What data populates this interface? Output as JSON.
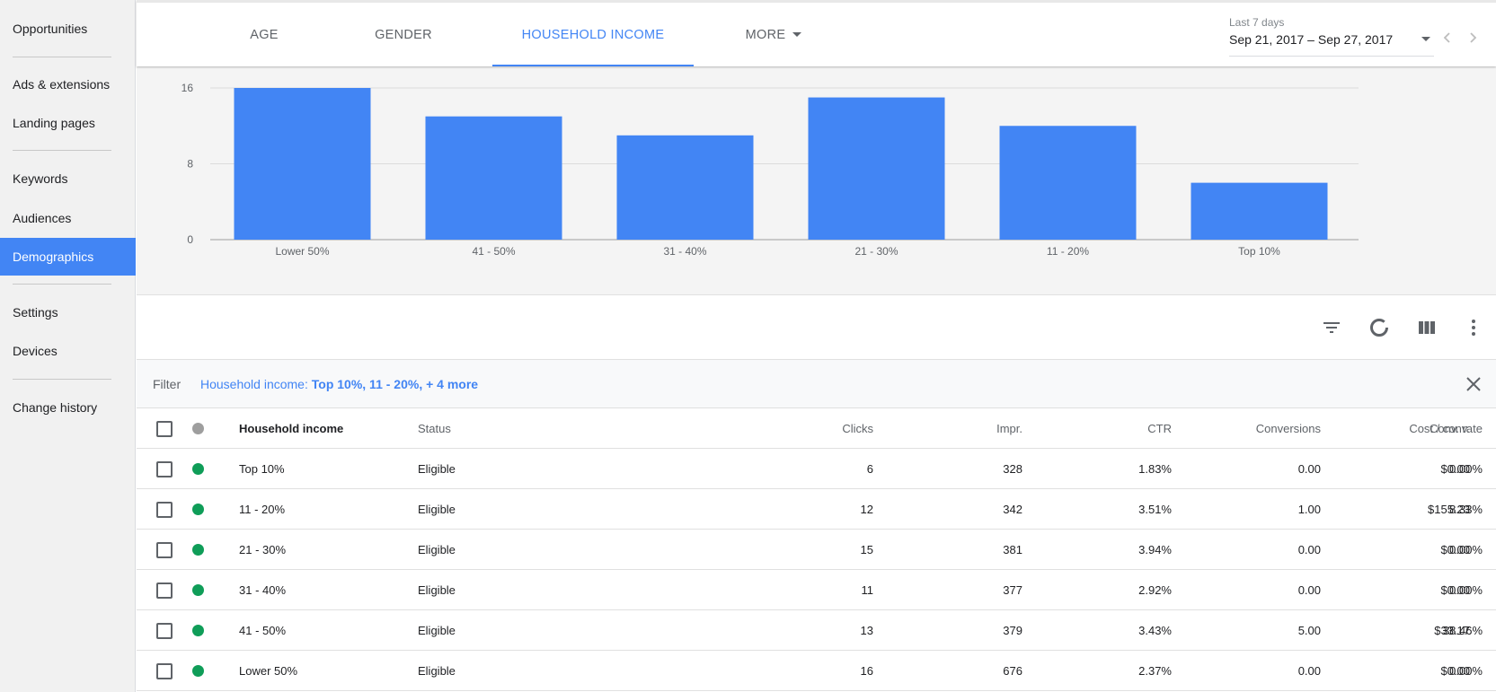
{
  "sidebar": {
    "items": [
      {
        "label": "Opportunities",
        "active": false
      },
      {
        "label": "Ads & extensions",
        "active": false
      },
      {
        "label": "Landing pages",
        "active": false
      },
      {
        "label": "Keywords",
        "active": false
      },
      {
        "label": "Audiences",
        "active": false
      },
      {
        "label": "Demographics",
        "active": true
      },
      {
        "label": "Settings",
        "active": false
      },
      {
        "label": "Devices",
        "active": false
      },
      {
        "label": "Change history",
        "active": false
      }
    ]
  },
  "tabs": [
    {
      "label": "AGE",
      "active": false
    },
    {
      "label": "GENDER",
      "active": false
    },
    {
      "label": "HOUSEHOLD INCOME",
      "active": true
    },
    {
      "label": "MORE",
      "active": false,
      "dropdown": true
    }
  ],
  "date_range": {
    "label": "Last 7 days",
    "value": "Sep 21, 2017 – Sep 27, 2017",
    "prev_icon": "chevron-left-icon",
    "next_icon": "chevron-right-icon"
  },
  "colors": {
    "accent": "#4285f4",
    "bar": "#4285f4",
    "status_eligible": "#0f9d58",
    "status_header": "#9e9e9e"
  },
  "chart_data": {
    "type": "bar",
    "categories": [
      "Lower 50%",
      "41 - 50%",
      "31 - 40%",
      "21 - 30%",
      "11 - 20%",
      "Top 10%"
    ],
    "values": [
      16,
      13,
      11,
      15,
      12,
      6
    ],
    "yticks": [
      0,
      8,
      16
    ],
    "ylim": [
      0,
      16
    ],
    "grid": true
  },
  "toolbar": {
    "icons": [
      "filter-icon",
      "segment-icon",
      "columns-icon",
      "more-vert-icon"
    ]
  },
  "filter": {
    "label": "Filter",
    "prefix": "Household income: ",
    "value": "Top 10%, 11 - 20%, + 4 more"
  },
  "table": {
    "headers": {
      "name": "Household income",
      "status": "Status",
      "clicks": "Clicks",
      "impr": "Impr.",
      "ctr": "CTR",
      "conversions": "Conversions",
      "cost_conv": "Cost / conv.",
      "conv_rate": "Conv. rate"
    },
    "rows": [
      {
        "name": "Top 10%",
        "status": "Eligible",
        "clicks": "6",
        "impr": "328",
        "ctr": "1.83%",
        "conversions": "0.00",
        "cost_conv": "$0.00",
        "conv_rate": "0.00%"
      },
      {
        "name": "11 - 20%",
        "status": "Eligible",
        "clicks": "12",
        "impr": "342",
        "ctr": "3.51%",
        "conversions": "1.00",
        "cost_conv": "$155.23",
        "conv_rate": "8.33%"
      },
      {
        "name": "21 - 30%",
        "status": "Eligible",
        "clicks": "15",
        "impr": "381",
        "ctr": "3.94%",
        "conversions": "0.00",
        "cost_conv": "$0.00",
        "conv_rate": "0.00%"
      },
      {
        "name": "31 - 40%",
        "status": "Eligible",
        "clicks": "11",
        "impr": "377",
        "ctr": "2.92%",
        "conversions": "0.00",
        "cost_conv": "$0.00",
        "conv_rate": "0.00%"
      },
      {
        "name": "41 - 50%",
        "status": "Eligible",
        "clicks": "13",
        "impr": "379",
        "ctr": "3.43%",
        "conversions": "5.00",
        "cost_conv": "$33.17",
        "conv_rate": "38.46%"
      },
      {
        "name": "Lower 50%",
        "status": "Eligible",
        "clicks": "16",
        "impr": "676",
        "ctr": "2.37%",
        "conversions": "0.00",
        "cost_conv": "$0.00",
        "conv_rate": "0.00%"
      }
    ]
  }
}
